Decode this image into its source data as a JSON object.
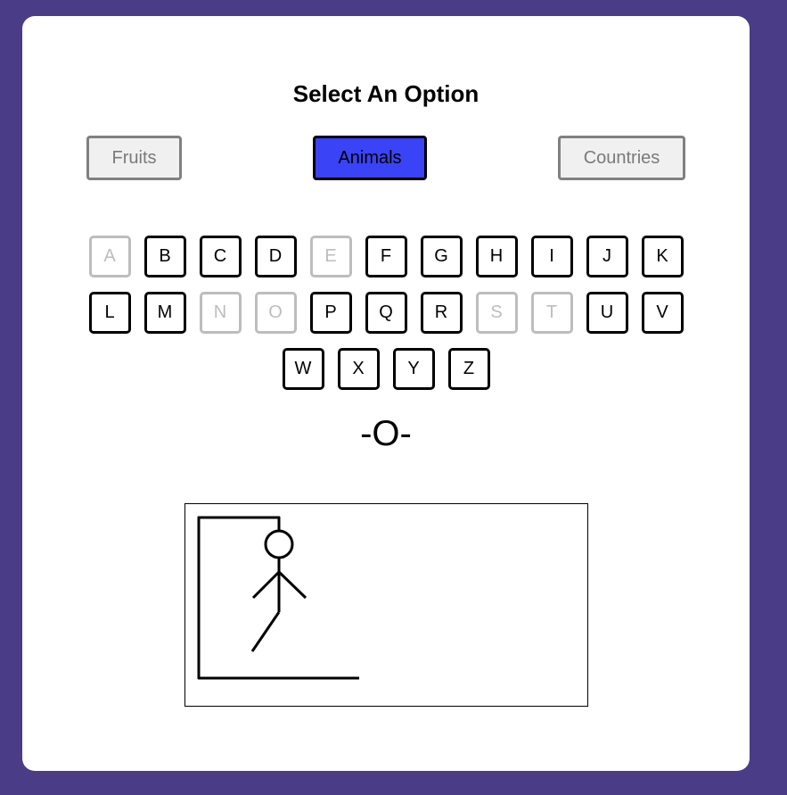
{
  "title": "Select An Option",
  "options": [
    {
      "label": "Fruits",
      "selected": false
    },
    {
      "label": "Animals",
      "selected": true
    },
    {
      "label": "Countries",
      "selected": false
    }
  ],
  "letters": [
    {
      "char": "A",
      "used": true
    },
    {
      "char": "B",
      "used": false
    },
    {
      "char": "C",
      "used": false
    },
    {
      "char": "D",
      "used": false
    },
    {
      "char": "E",
      "used": true
    },
    {
      "char": "F",
      "used": false
    },
    {
      "char": "G",
      "used": false
    },
    {
      "char": "H",
      "used": false
    },
    {
      "char": "I",
      "used": false
    },
    {
      "char": "J",
      "used": false
    },
    {
      "char": "K",
      "used": false
    },
    {
      "char": "L",
      "used": false
    },
    {
      "char": "M",
      "used": false
    },
    {
      "char": "N",
      "used": true
    },
    {
      "char": "O",
      "used": true
    },
    {
      "char": "P",
      "used": false
    },
    {
      "char": "Q",
      "used": false
    },
    {
      "char": "R",
      "used": false
    },
    {
      "char": "S",
      "used": true
    },
    {
      "char": "T",
      "used": true
    },
    {
      "char": "U",
      "used": false
    },
    {
      "char": "V",
      "used": false
    },
    {
      "char": "W",
      "used": false
    },
    {
      "char": "X",
      "used": false
    },
    {
      "char": "Y",
      "used": false
    },
    {
      "char": "Z",
      "used": false
    }
  ],
  "word_display": "-O-",
  "colors": {
    "background": "#4a3c86",
    "selected_option": "#3a43f5",
    "used_letter": "#bdbdbd"
  }
}
